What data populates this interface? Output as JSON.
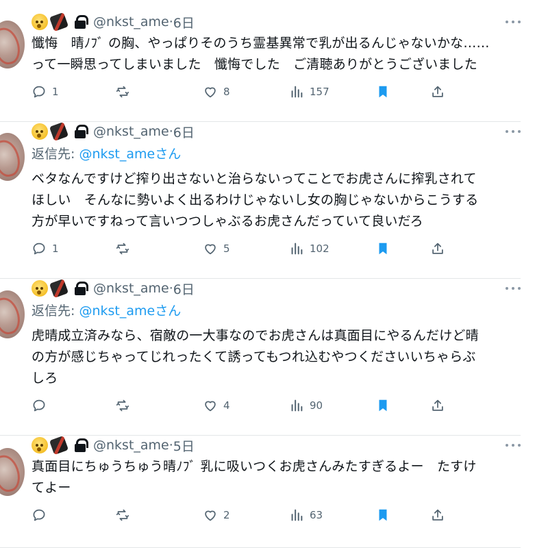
{
  "colors": {
    "accent": "#1d9bf0",
    "bookmark": "#1d9bf0",
    "muted": "#536471",
    "text": "#0f1419"
  },
  "icons": {
    "reply": "reply-icon",
    "retweet": "retweet-icon",
    "like": "heart-icon",
    "views": "views-icon",
    "bookmark": "bookmark-icon",
    "share": "share-icon",
    "lock": "lock-icon",
    "more": "more-icon"
  },
  "tweets": [
    {
      "handle": "@nkst_ame",
      "time": "6日",
      "reply_label": "",
      "reply_handle": "",
      "reply_suffix": "",
      "text": "懺悔　晴ﾉﾌﾞ の胸、やっぱりそのうち霊基異常で乳が出るんじゃないかな……\nって一瞬思ってしまいました　懺悔でした　ご清聴ありがとうございました",
      "replies": "1",
      "retweets": "",
      "likes": "8",
      "views": "157"
    },
    {
      "handle": "@nkst_ame",
      "time": "6日",
      "reply_label": "返信先: ",
      "reply_handle": "@nkst_ame",
      "reply_suffix": "さん",
      "text": "ベタなんですけど搾り出さないと治らないってことでお虎さんに搾乳されて\nほしい　そんなに勢いよく出るわけじゃないし女の胸じゃないからこうする\n方が早いですねって言いつつしゃぶるお虎さんだっていて良いだろ",
      "replies": "1",
      "retweets": "",
      "likes": "5",
      "views": "102"
    },
    {
      "handle": "@nkst_ame",
      "time": "6日",
      "reply_label": "返信先: ",
      "reply_handle": "@nkst_ame",
      "reply_suffix": "さん",
      "text": "虎晴成立済みなら、宿敵の一大事なのでお虎さんは真面目にやるんだけど晴\nの方が感じちゃってじれったくて誘ってもつれ込むやつくださいいちゃらぶ\nしろ",
      "replies": "",
      "retweets": "",
      "likes": "4",
      "views": "90"
    },
    {
      "handle": "@nkst_ame",
      "time": "5日",
      "reply_label": "",
      "reply_handle": "",
      "reply_suffix": "",
      "text": "真面目にちゅうちゅう晴ﾉﾌﾞ 乳に吸いつくお虎さんみたすぎるよー　たすけ\nてよー",
      "replies": "",
      "retweets": "",
      "likes": "2",
      "views": "63"
    }
  ]
}
